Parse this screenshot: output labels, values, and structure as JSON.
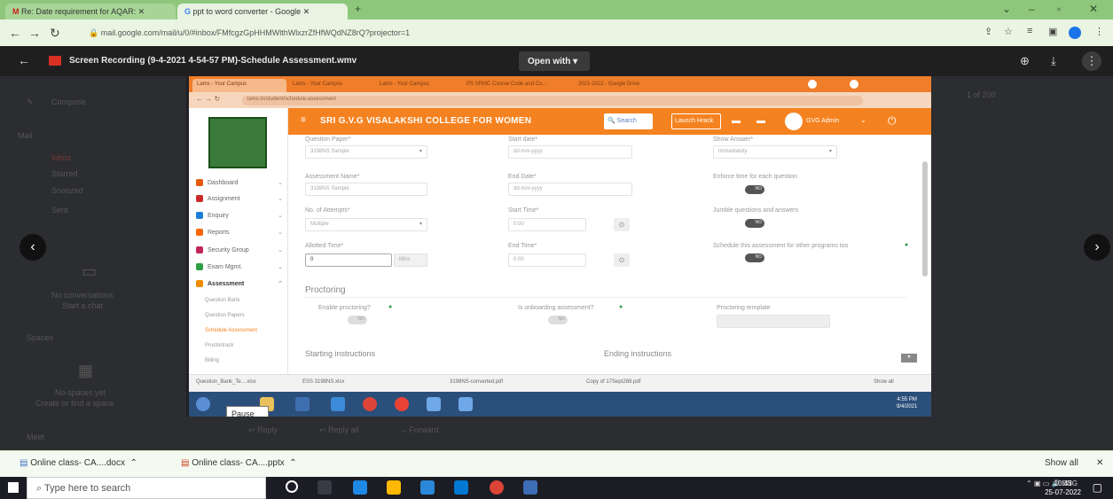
{
  "outer_browser": {
    "tabs": [
      {
        "label": "Re: Date requirement for AQAR:"
      },
      {
        "label": "ppt to word converter - Google"
      }
    ],
    "url": "mail.google.com/mail/u/0/#inbox/FMfcgzGpHHMWlthWlxzrZfHfWQdNZ8rQ?projector=1",
    "minimize": "–",
    "maximize": "▫",
    "close": "✕"
  },
  "viewer": {
    "file_title": "Screen Recording (9-4-2021 4-54-57 PM)-Schedule Assessment.wmv",
    "open_with": "Open with ▾"
  },
  "gmail_bg": {
    "compose": "Compose",
    "mail": "Mail",
    "inbox": "Inbox",
    "starred": "Starred",
    "snoozed": "Snoozed",
    "sent": "Sent",
    "spaces": "Spaces",
    "meet": "Meet",
    "no_conv": "No conversations",
    "start_chat": "Start a chat",
    "no_spaces": "No spaces yet",
    "create_space": "Create or find a space",
    "pager": "1 of 200",
    "bottom_actions": [
      "Reply",
      "Reply all",
      "Forward"
    ]
  },
  "inner_browser": {
    "tabs": [
      "Lams - Your Campus",
      "Lams - Your Campus",
      "Lams - Your Campus",
      "PS SRMC Course Code and Co...",
      "2021-2022 - Google Drive"
    ],
    "url": "lams.in/student/schedule-assessment"
  },
  "app": {
    "college": "SRI G.V.G VISALAKSHI COLLEGE FOR WOMEN",
    "search": "Search",
    "launch": "Launch Hrack",
    "user": "GVG Admin"
  },
  "sidebar": {
    "items": [
      {
        "label": "Dashboard",
        "color": "#e8590c"
      },
      {
        "label": "Assignment",
        "color": "#c92a2a"
      },
      {
        "label": "Enquiry",
        "color": "#1c7ed6"
      },
      {
        "label": "Reports",
        "color": "#f76707"
      },
      {
        "label": "Security Group",
        "color": "#c2255c"
      },
      {
        "label": "Exam Mgmt.",
        "color": "#2f9e44"
      },
      {
        "label": "Assessment",
        "color": "#f08c00"
      }
    ],
    "subitems": [
      "Question Bank",
      "Question Papers",
      "Schedule Assessment",
      "Proctortrack",
      "Billing"
    ]
  },
  "form": {
    "question_paper_label": "Question Paper*",
    "question_paper_value": "3198NS Sample",
    "start_date_label": "Start date*",
    "start_date_ph": "dd-mm-yyyy",
    "show_answer_label": "Show Answer*",
    "show_answer_value": "Immediately",
    "assessment_name_label": "Assessment Name*",
    "assessment_name_value": "3198NS Sample",
    "end_date_label": "End Date*",
    "end_date_ph": "dd-mm-yyyy",
    "enforce_label": "Enforce time for each question",
    "attempts_label": "No. of Attempts*",
    "attempts_value": "Multiple",
    "start_time_label": "Start Time*",
    "start_time_ph": "0:00",
    "jumble_label": "Jumble questions and answers",
    "allotted_label": "Allotted Time*",
    "allotted_value": "0",
    "allotted_unit": "Mins",
    "end_time_label": "End Time*",
    "end_time_ph": "0:00",
    "schedule_other_label": "Schedule this assessment for other programs too",
    "toggle_no": "NO",
    "proctoring_title": "Proctoring",
    "enable_proctoring": "Enable proctoring?",
    "is_onboarding": "Is onboarding assessment?",
    "proctoring_template": "Proctoring template",
    "starting_instructions": "Starting instructions",
    "ending_instructions": "Ending instructions"
  },
  "inner_downloads": {
    "items": [
      "Question_Bank_Te....xlsx",
      "ESS 3198NS.xlsx",
      "3198NS-converted.pdf",
      "Copy of 17Sept269.pdf"
    ],
    "show_all": "Show all"
  },
  "inner_clock": {
    "time": "4:55 PM",
    "date": "9/4/2021"
  },
  "tooltip": "Pause (k)",
  "outer_downloads": {
    "items": [
      "Online class- CA....docx",
      "Online class- CA....pptx"
    ],
    "show_all": "Show all"
  },
  "taskbar": {
    "search_placeholder": "Type here to search",
    "lang": "ENG",
    "time": "10:43",
    "date": "25-07-2022"
  }
}
